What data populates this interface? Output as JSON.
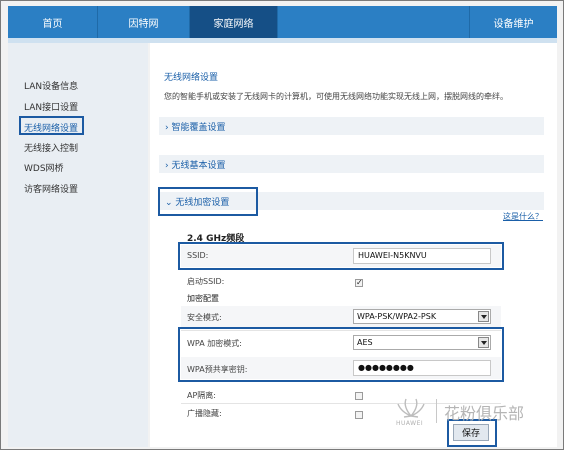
{
  "nav": {
    "tabs": [
      {
        "label": "首页",
        "active": false
      },
      {
        "label": "因特网",
        "active": false
      },
      {
        "label": "家庭网络",
        "active": true
      },
      {
        "label": "设备维护",
        "active": false
      }
    ]
  },
  "sidebar": {
    "items": [
      {
        "label": "LAN设备信息"
      },
      {
        "label": "LAN接口设置"
      },
      {
        "label": "无线网络设置",
        "active": true
      },
      {
        "label": "无线接入控制"
      },
      {
        "label": "WDS网桥"
      },
      {
        "label": "访客网络设置"
      }
    ]
  },
  "main": {
    "title": "无线网络设置",
    "description": "您的智能手机或安装了无线网卡的计算机，可使用无线网络功能实现无线上网，摆脱网线的牵绊。",
    "sections": [
      {
        "label": "› 智能覆盖设置"
      },
      {
        "label": "› 无线基本设置"
      },
      {
        "label": "⌄ 无线加密设置"
      }
    ],
    "help_link": "这是什么？",
    "band_title": "2.4 GHz频段",
    "fields": {
      "ssid_label": "SSID:",
      "ssid_value": "HUAWEI-N5KNVU",
      "enable_ssid_label": "启动SSID:",
      "enable_ssid_checked": "✓",
      "encryption_config_label": "加密配置",
      "security_mode_label": "安全模式:",
      "security_mode_value": "WPA-PSK/WPA2-PSK",
      "wpa_encryption_label": "WPA 加密模式:",
      "wpa_encryption_value": "AES",
      "wpa_psk_label": "WPA预共享密钥:",
      "wpa_psk_value": "●●●●●●●●",
      "ap_isolation_label": "AP隔离:",
      "broadcast_hide_label": "广播隐藏:"
    },
    "save_label": "保存"
  },
  "watermark": {
    "brand": "HUAWEI",
    "text": "花粉俱乐部"
  },
  "colors": {
    "nav_bg": "#2b7fc4",
    "nav_active": "#154f86",
    "highlight": "#1c5aa2",
    "link": "#1a5fa8"
  }
}
